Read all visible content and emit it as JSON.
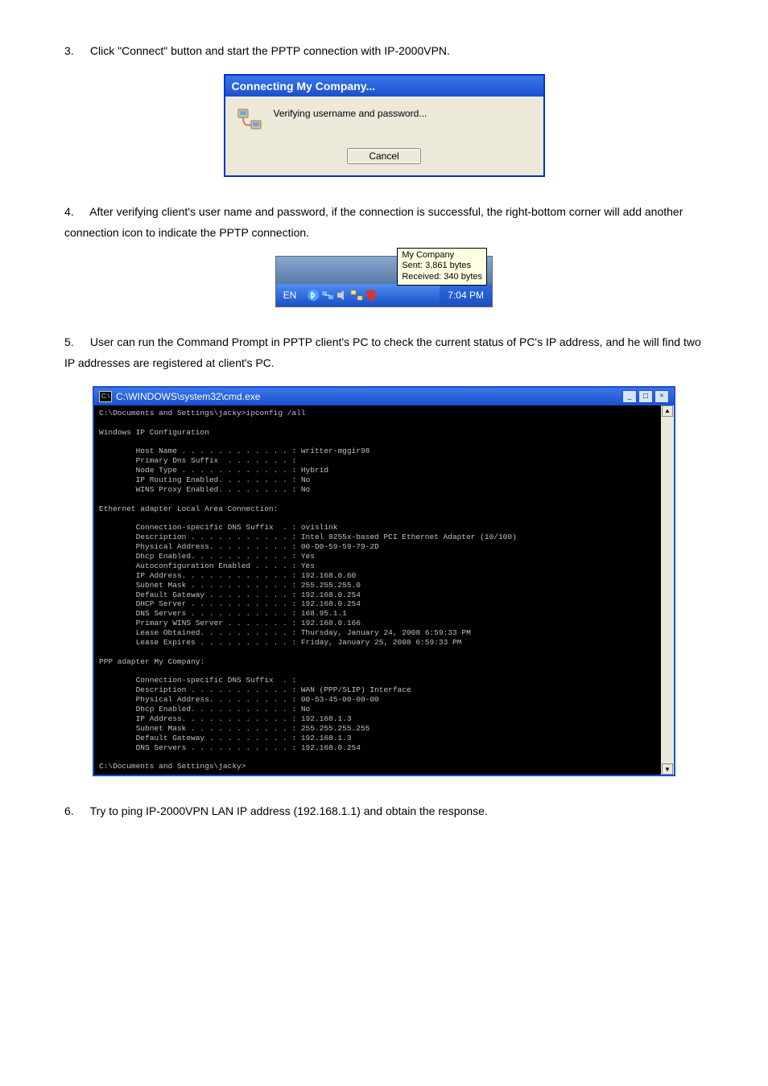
{
  "step3": {
    "num": "3.",
    "text": "Click \"Connect\" button and start the PPTP connection with IP-2000VPN."
  },
  "dialog": {
    "title": "Connecting My Company...",
    "message": "Verifying username and password...",
    "cancel": "Cancel"
  },
  "step4": {
    "num": "4.",
    "text": "After verifying client's user name and password, if the connection is successful, the right-bottom corner will add another connection icon to indicate the PPTP connection."
  },
  "tray": {
    "tip_line1": "My Company",
    "tip_line2": "Sent: 3,861 bytes",
    "tip_line3": "Received: 340 bytes",
    "lang": "EN",
    "time": "7:04 PM"
  },
  "step5": {
    "num": "5.",
    "text": "User can run the Command Prompt in PPTP client's PC to check the current status of PC's IP address, and he will find two IP addresses are registered at client's PC."
  },
  "cmd": {
    "title": "C:\\WINDOWS\\system32\\cmd.exe",
    "icon_text": "C:\\",
    "body": "C:\\Documents and Settings\\jacky>ipconfig /all\n\nWindows IP Configuration\n\n        Host Name . . . . . . . . . . . . : writter-mggir98\n        Primary Dns Suffix  . . . . . . . :\n        Node Type . . . . . . . . . . . . : Hybrid\n        IP Routing Enabled. . . . . . . . : No\n        WINS Proxy Enabled. . . . . . . . : No\n\nEthernet adapter Local Area Connection:\n\n        Connection-specific DNS Suffix  . : ovislink\n        Description . . . . . . . . . . . : Intel 8255x-based PCI Ethernet Adapter (10/100)\n        Physical Address. . . . . . . . . : 00-D0-59-59-79-2D\n        Dhcp Enabled. . . . . . . . . . . : Yes\n        Autoconfiguration Enabled . . . . : Yes\n        IP Address. . . . . . . . . . . . : 192.168.0.60\n        Subnet Mask . . . . . . . . . . . : 255.255.255.0\n        Default Gateway . . . . . . . . . : 192.168.0.254\n        DHCP Server . . . . . . . . . . . : 192.168.0.254\n        DNS Servers . . . . . . . . . . . : 168.95.1.1\n        Primary WINS Server . . . . . . . : 192.168.0.166\n        Lease Obtained. . . . . . . . . . : Thursday, January 24, 2008 6:59:33 PM\n        Lease Expires . . . . . . . . . . : Friday, January 25, 2008 6:59:33 PM\n\nPPP adapter My Company:\n\n        Connection-specific DNS Suffix  . :\n        Description . . . . . . . . . . . : WAN (PPP/SLIP) Interface\n        Physical Address. . . . . . . . . : 00-53-45-00-00-00\n        Dhcp Enabled. . . . . . . . . . . : No\n        IP Address. . . . . . . . . . . . : 192.168.1.3\n        Subnet Mask . . . . . . . . . . . : 255.255.255.255\n        Default Gateway . . . . . . . . . : 192.168.1.3\n        DNS Servers . . . . . . . . . . . : 192.168.0.254\n\nC:\\Documents and Settings\\jacky>"
  },
  "step6": {
    "num": "6.",
    "text": "Try to ping IP-2000VPN LAN IP address (192.168.1.1) and obtain the response."
  }
}
